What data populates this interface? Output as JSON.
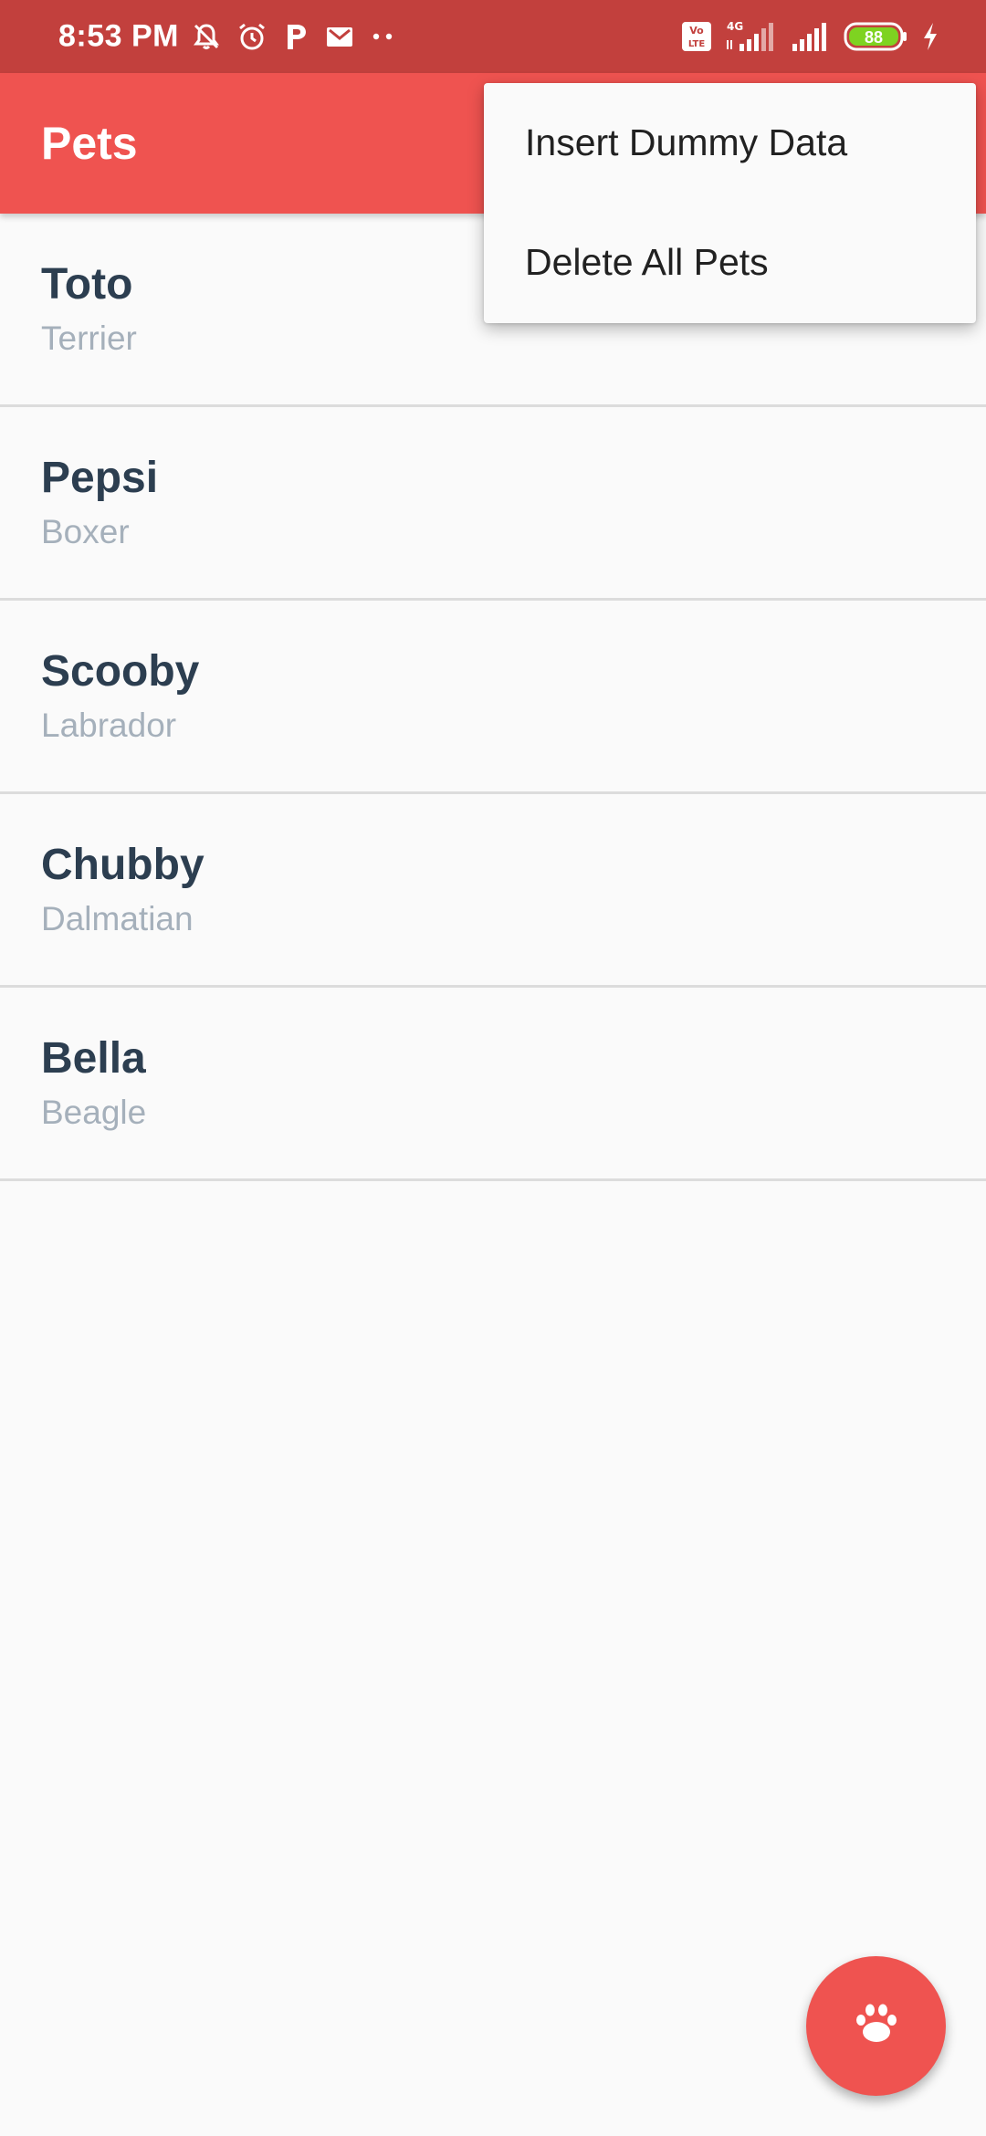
{
  "status_bar": {
    "time": "8:53 PM",
    "battery_level": "88",
    "network_type": "4G",
    "volte_label": "Vo LTE",
    "left_icons": [
      "notifications-muted-icon",
      "alarm-icon",
      "p-app-icon",
      "gmail-icon",
      "more-dots-icon"
    ],
    "right_icons": [
      "volte-icon",
      "signal-4g-icon",
      "signal-icon",
      "battery-icon",
      "charging-icon"
    ]
  },
  "app_bar": {
    "title": "Pets",
    "color": "#ef5350"
  },
  "overflow_menu": {
    "items": [
      {
        "label": "Insert Dummy Data"
      },
      {
        "label": "Delete All Pets"
      }
    ]
  },
  "pets": [
    {
      "name": "Toto",
      "breed": "Terrier"
    },
    {
      "name": "Pepsi",
      "breed": "Boxer"
    },
    {
      "name": "Scooby",
      "breed": "Labrador"
    },
    {
      "name": "Chubby",
      "breed": "Dalmatian"
    },
    {
      "name": "Bella",
      "breed": "Beagle"
    }
  ],
  "fab": {
    "icon": "paw-icon",
    "color": "#ef5350"
  },
  "colors": {
    "status_bar": "#c2403d",
    "pet_name": "#2c3e50",
    "pet_breed": "#a5b0bb",
    "background": "#fafafa",
    "battery_fill": "#7ed321"
  }
}
